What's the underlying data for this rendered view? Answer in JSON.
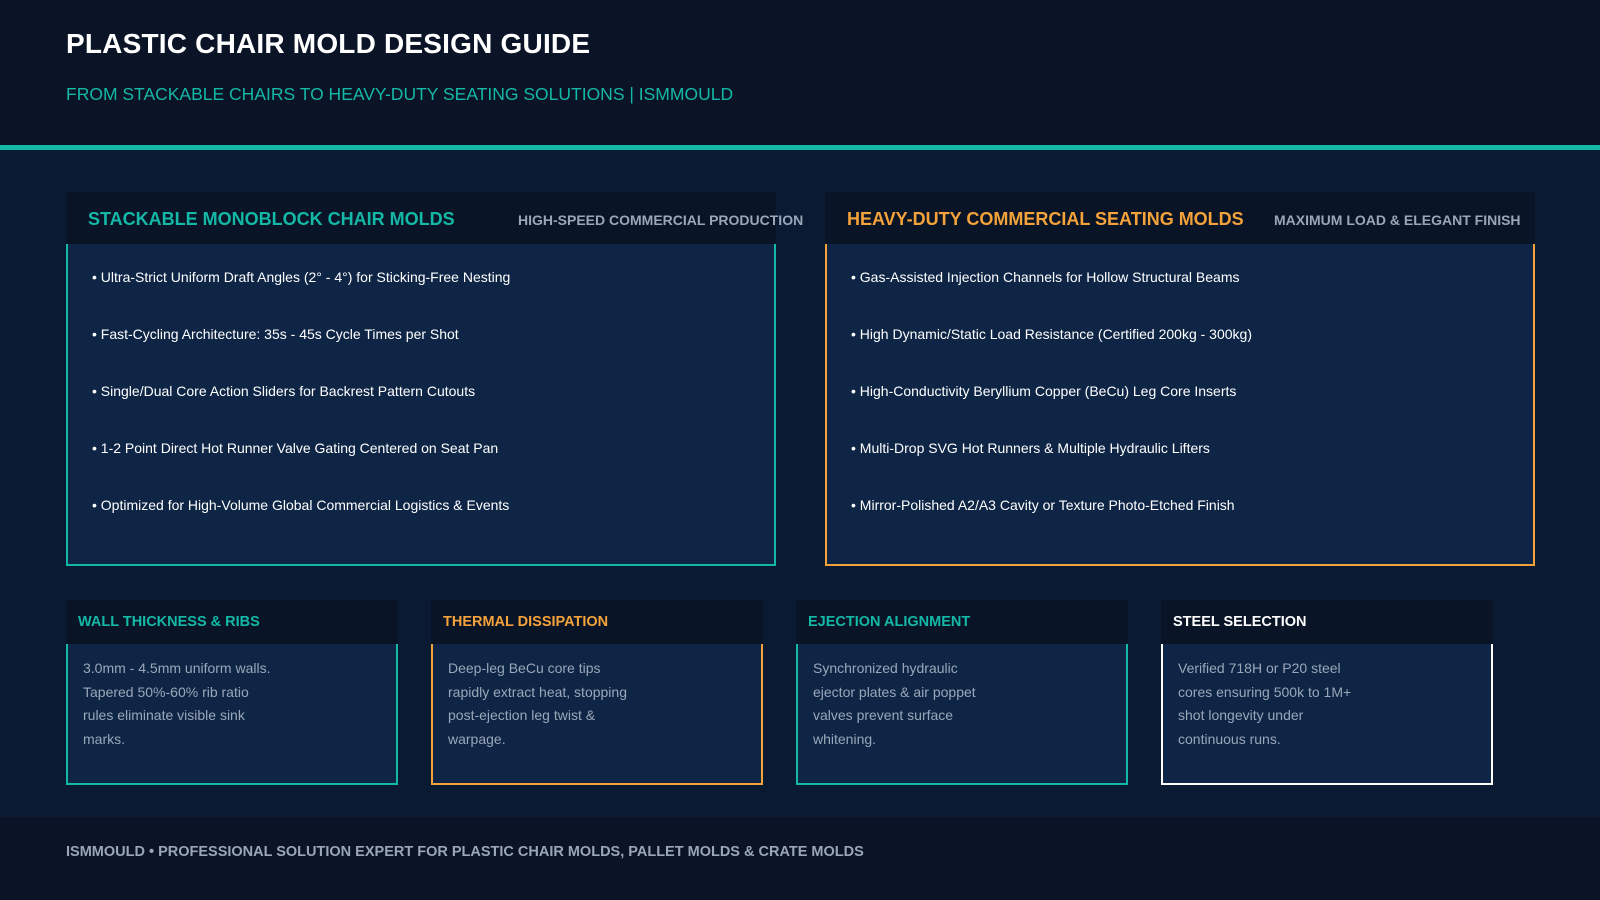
{
  "header": {
    "title": "PLASTIC CHAIR MOLD DESIGN GUIDE",
    "subtitle": "FROM STACKABLE CHAIRS TO HEAVY-DUTY SEATING SOLUTIONS | ISMMOULD"
  },
  "colors": {
    "background": "#0b1a33",
    "header_bg": "#0a1426",
    "teal": "#14b8a6",
    "orange": "#f4a23a",
    "white": "#ffffff",
    "muted": "#9aa7b8"
  },
  "cards": [
    {
      "title": "STACKABLE MONOBLOCK CHAIR MOLDS",
      "tag": "HIGH-SPEED COMMERCIAL PRODUCTION",
      "bullets": [
        "• Ultra-Strict Uniform Draft Angles (2° - 4°) for Sticking-Free Nesting",
        "• Fast-Cycling Architecture: 35s - 45s Cycle Times per Shot",
        "• Single/Dual Core Action Sliders for Backrest Pattern Cutouts",
        "• 1-2 Point Direct Hot Runner Valve Gating Centered on Seat Pan",
        "• Optimized for High-Volume Global Commercial Logistics & Events"
      ]
    },
    {
      "title": "HEAVY-DUTY COMMERCIAL SEATING MOLDS",
      "tag": "MAXIMUM LOAD & ELEGANT FINISH",
      "bullets": [
        "• Gas-Assisted Injection Channels for Hollow Structural Beams",
        "• High Dynamic/Static Load Resistance (Certified 200kg - 300kg)",
        "• High-Conductivity Beryllium Copper (BeCu) Leg Core Inserts",
        "• Multi-Drop SVG Hot Runners & Multiple Hydraulic Lifters",
        "• Mirror-Polished A2/A3 Cavity or Texture Photo-Etched Finish"
      ]
    }
  ],
  "features": [
    {
      "title": "WALL THICKNESS & RIBS",
      "body": "3.0mm - 4.5mm uniform walls. Tapered 50%-60% rib ratio rules eliminate visible sink marks."
    },
    {
      "title": "THERMAL DISSIPATION",
      "body": "Deep-leg BeCu core tips rapidly extract heat, stopping post-ejection leg twist & warpage."
    },
    {
      "title": "EJECTION ALIGNMENT",
      "body": "Synchronized hydraulic ejector plates & air poppet valves prevent surface whitening."
    },
    {
      "title": "STEEL SELECTION",
      "body": "Verified 718H or P20 steel cores ensuring 500k to 1M+ shot longevity under continuous runs."
    }
  ],
  "footer": {
    "text": "ISMMOULD • PROFESSIONAL SOLUTION EXPERT FOR PLASTIC CHAIR MOLDS, PALLET MOLDS & CRATE MOLDS"
  }
}
